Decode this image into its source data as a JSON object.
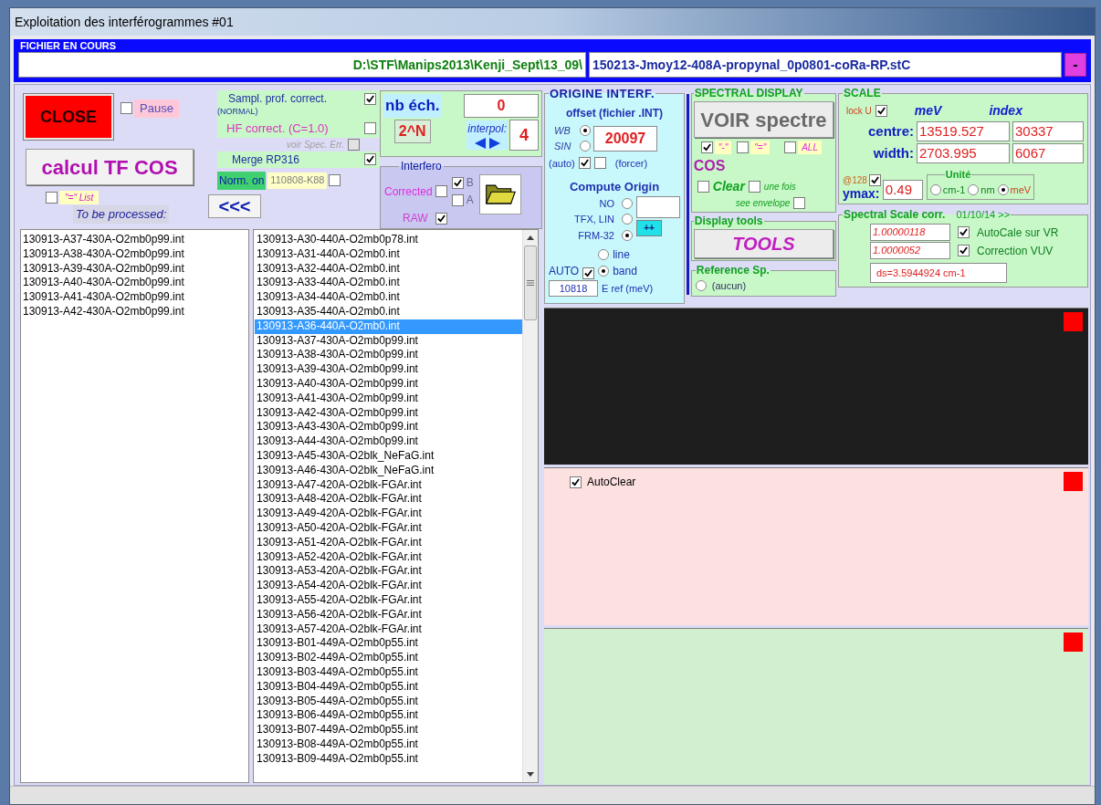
{
  "window": {
    "title": "Exploitation des interférogrammes #01"
  },
  "current_file": {
    "legend": "FICHIER EN COURS",
    "folder": "D:\\STF\\Manips2013\\Kenji_Sept\\13_09\\",
    "file": "150213-Jmoy12-408A-propynal_0p0801-coRa-RP.stC",
    "minimize_button": "-"
  },
  "main": {
    "close_button": "CLOSE",
    "pause": {
      "label": "Pause",
      "checked": false
    },
    "calc_button": "calcul TF COS",
    "list_option": {
      "label": "\"=\" List",
      "checked": false
    },
    "to_be_processed": "To be processed:",
    "back_button": "<<<"
  },
  "corrections": {
    "sampling": {
      "label": "Sampl. prof. correct.",
      "note": "(NORMAL)",
      "checked": true
    },
    "hf": {
      "label": "HF correct. (C=1.0)",
      "checked": false
    },
    "spec_err": {
      "label": "voir Spec. Err.",
      "checked": false,
      "disabled": true
    },
    "merge": {
      "label": "Merge RP316",
      "checked": true
    },
    "norm": {
      "label": "Norm. on",
      "value": "110808-K88",
      "checked": false
    }
  },
  "samples": {
    "label": "nb éch.",
    "value": "0",
    "pow2_button": "2^N",
    "interpol_label": "interpol:",
    "interpol_value": "4"
  },
  "interfero": {
    "legend": "Interfero",
    "corrected": {
      "label": "Corrected",
      "checked": false
    },
    "b": {
      "label": "B",
      "checked": true
    },
    "a": {
      "label": "A",
      "checked": false
    },
    "raw": {
      "label": "RAW",
      "checked": true
    }
  },
  "origin": {
    "legend": "ORIGINE INTERF.",
    "offset_title": "offset (fichier .INT)",
    "modes": [
      {
        "label": "WB",
        "selected": true
      },
      {
        "label": "SIN",
        "selected": false
      }
    ],
    "offset_value": "20097",
    "auto": {
      "label": "(auto)",
      "checked": true
    },
    "force": {
      "label": "(forcer)",
      "checked": false
    },
    "compute_title": "Compute Origin",
    "methods": [
      {
        "label": "NO",
        "selected": false
      },
      {
        "label": "TFX, LIN",
        "selected": false
      },
      {
        "label": "FRM-32",
        "selected": true
      }
    ],
    "plus_button": "++",
    "auto_ref": {
      "label": "AUTO",
      "checked": true
    },
    "ref_modes": [
      {
        "label": "line",
        "selected": false
      },
      {
        "label": "band",
        "selected": true
      }
    ],
    "eref_value": "10818",
    "eref_label": "E ref (meV)"
  },
  "spectral_display": {
    "legend": "SPECTRAL DISPLAY",
    "voir_button": "VOIR spectre",
    "styles": [
      {
        "label": "\"-\"",
        "checked": true
      },
      {
        "label": "\"=\"",
        "checked": false
      },
      {
        "label": "ALL",
        "checked": false
      }
    ],
    "cos_label": "COS",
    "clear": {
      "label": "Clear",
      "checked": false
    },
    "once": {
      "label": "une fois",
      "checked": false
    },
    "envelope": {
      "label": "see envelope",
      "checked": false
    }
  },
  "display_tools": {
    "legend": "Display tools",
    "tools_button": "TOOLS"
  },
  "reference": {
    "legend": "Reference Sp.",
    "option": {
      "label": "(aucun)",
      "selected": false
    }
  },
  "scale": {
    "legend": "SCALE",
    "lock": {
      "label": "lock U",
      "checked": true
    },
    "col_1": "meV",
    "col_2": "index",
    "rows": [
      {
        "label": "centre:",
        "mev": "13519.527",
        "index": "30337"
      },
      {
        "label": "width:",
        "mev": "2703.995",
        "index": "6067"
      }
    ],
    "at128": {
      "label": "@128",
      "checked": true
    },
    "ymax_label": "ymax:",
    "ymax": "0.49",
    "unit_legend": "Unité",
    "units": [
      {
        "label": "cm-1",
        "selected": false
      },
      {
        "label": "nm",
        "selected": false
      },
      {
        "label": "meV",
        "selected": true
      }
    ]
  },
  "scale_corr": {
    "legend": "Spectral Scale corr.",
    "date": "01/10/14 >>",
    "rows": [
      {
        "value": "1.00000118",
        "label": "AutoCale sur VR",
        "checked": true
      },
      {
        "value": "1.0000052",
        "label": "Correction VUV",
        "checked": true
      }
    ],
    "ds": "ds=3.5944924 cm-1"
  },
  "queue_list": [
    "130913-A37-430A-O2mb0p99.int",
    "130913-A38-430A-O2mb0p99.int",
    "130913-A39-430A-O2mb0p99.int",
    "130913-A40-430A-O2mb0p99.int",
    "130913-A41-430A-O2mb0p99.int",
    "130913-A42-430A-O2mb0p99.int"
  ],
  "file_list": [
    {
      "name": "130913-A30-440A-O2mb0p78.int",
      "selected": false
    },
    {
      "name": "130913-A31-440A-O2mb0.int",
      "selected": false
    },
    {
      "name": "130913-A32-440A-O2mb0.int",
      "selected": false
    },
    {
      "name": "130913-A33-440A-O2mb0.int",
      "selected": false
    },
    {
      "name": "130913-A34-440A-O2mb0.int",
      "selected": false
    },
    {
      "name": "130913-A35-440A-O2mb0.int",
      "selected": false
    },
    {
      "name": "130913-A36-440A-O2mb0.int",
      "selected": true
    },
    {
      "name": "130913-A37-430A-O2mb0p99.int",
      "selected": false
    },
    {
      "name": "130913-A38-430A-O2mb0p99.int",
      "selected": false
    },
    {
      "name": "130913-A39-430A-O2mb0p99.int",
      "selected": false
    },
    {
      "name": "130913-A40-430A-O2mb0p99.int",
      "selected": false
    },
    {
      "name": "130913-A41-430A-O2mb0p99.int",
      "selected": false
    },
    {
      "name": "130913-A42-430A-O2mb0p99.int",
      "selected": false
    },
    {
      "name": "130913-A43-430A-O2mb0p99.int",
      "selected": false
    },
    {
      "name": "130913-A44-430A-O2mb0p99.int",
      "selected": false
    },
    {
      "name": "130913-A45-430A-O2blk_NeFaG.int",
      "selected": false
    },
    {
      "name": "130913-A46-430A-O2blk_NeFaG.int",
      "selected": false
    },
    {
      "name": "130913-A47-420A-O2blk-FGAr.int",
      "selected": false
    },
    {
      "name": "130913-A48-420A-O2blk-FGAr.int",
      "selected": false
    },
    {
      "name": "130913-A49-420A-O2blk-FGAr.int",
      "selected": false
    },
    {
      "name": "130913-A50-420A-O2blk-FGAr.int",
      "selected": false
    },
    {
      "name": "130913-A51-420A-O2blk-FGAr.int",
      "selected": false
    },
    {
      "name": "130913-A52-420A-O2blk-FGAr.int",
      "selected": false
    },
    {
      "name": "130913-A53-420A-O2blk-FGAr.int",
      "selected": false
    },
    {
      "name": "130913-A54-420A-O2blk-FGAr.int",
      "selected": false
    },
    {
      "name": "130913-A55-420A-O2blk-FGAr.int",
      "selected": false
    },
    {
      "name": "130913-A56-420A-O2blk-FGAr.int",
      "selected": false
    },
    {
      "name": "130913-A57-420A-O2blk-FGAr.int",
      "selected": false
    },
    {
      "name": "130913-B01-449A-O2mb0p55.int",
      "selected": false
    },
    {
      "name": "130913-B02-449A-O2mb0p55.int",
      "selected": false
    },
    {
      "name": "130913-B03-449A-O2mb0p55.int",
      "selected": false
    },
    {
      "name": "130913-B04-449A-O2mb0p55.int",
      "selected": false
    },
    {
      "name": "130913-B05-449A-O2mb0p55.int",
      "selected": false
    },
    {
      "name": "130913-B06-449A-O2mb0p55.int",
      "selected": false
    },
    {
      "name": "130913-B07-449A-O2mb0p55.int",
      "selected": false
    },
    {
      "name": "130913-B08-449A-O2mb0p55.int",
      "selected": false
    },
    {
      "name": "130913-B09-449A-O2mb0p55.int",
      "selected": false
    }
  ],
  "plots": [
    {
      "kind": "dark"
    },
    {
      "kind": "rose",
      "autoclear": {
        "label": "AutoClear",
        "checked": true
      }
    },
    {
      "kind": "mint"
    }
  ]
}
